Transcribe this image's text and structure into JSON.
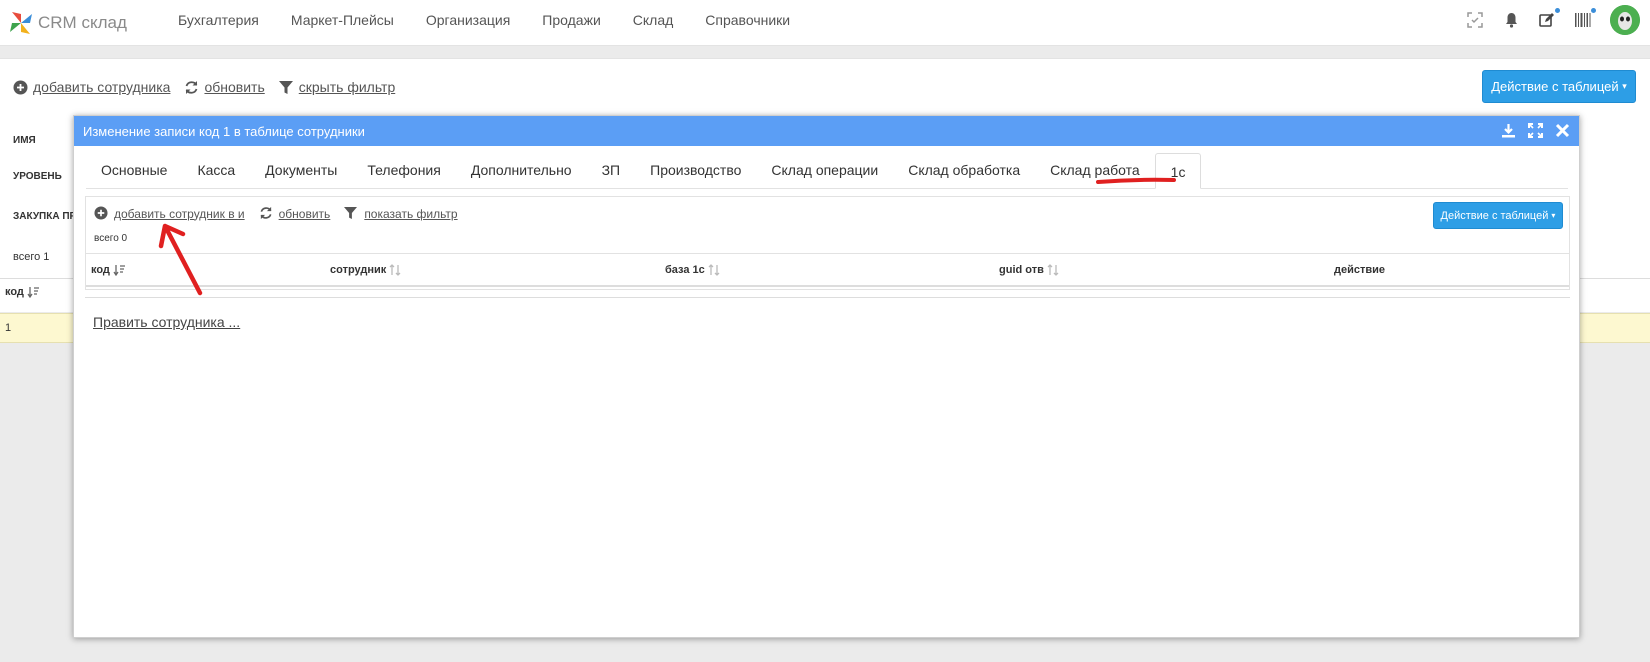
{
  "app": {
    "title": "CRM склад",
    "brand_colors": {
      "accent": "#2d9ee6",
      "modal_header": "#5b9ef5",
      "row_highlight": "#fdf8d0"
    }
  },
  "nav": {
    "items": [
      "Бухгалтерия",
      "Маркет-Плейсы",
      "Организация",
      "Продажи",
      "Склад",
      "Справочники"
    ],
    "icons": [
      "scan-icon",
      "bell-icon",
      "edit-icon",
      "barcode-icon",
      "avatar"
    ]
  },
  "background": {
    "toolbar": {
      "add_label": "добавить сотрудника",
      "refresh_label": "обновить",
      "filter_label": "скрыть фильтр"
    },
    "table_action_label": "Действие с таблицей",
    "filter_labels": {
      "name": "ИМЯ",
      "level": "УРОВЕНЬ",
      "purchase": "ЗАКУПКА ПР"
    },
    "total_label": "всего 1",
    "column_code": "код",
    "row_value": "1"
  },
  "modal": {
    "title": "Изменение записи код 1 в таблице сотрудники",
    "tabs": [
      {
        "label": "Основные",
        "active": false
      },
      {
        "label": "Касса",
        "active": false
      },
      {
        "label": "Документы",
        "active": false
      },
      {
        "label": "Телефония",
        "active": false
      },
      {
        "label": "Дополнительно",
        "active": false
      },
      {
        "label": "ЗП",
        "active": false
      },
      {
        "label": "Производство",
        "active": false
      },
      {
        "label": "Склад операции",
        "active": false
      },
      {
        "label": "Склад обработка",
        "active": false
      },
      {
        "label": "Склад работа",
        "active": false
      },
      {
        "label": "1с",
        "active": true
      }
    ],
    "inner": {
      "add_label": "добавить сотрудник в и",
      "refresh_label": "обновить",
      "filter_label": "показать фильтр",
      "table_action_label": "Действие с таблицей",
      "total_label": "всего 0",
      "columns": [
        "код",
        "сотрудник",
        "база 1с",
        "guid отв",
        "действие"
      ]
    },
    "edit_link": "Править сотрудника ..."
  }
}
